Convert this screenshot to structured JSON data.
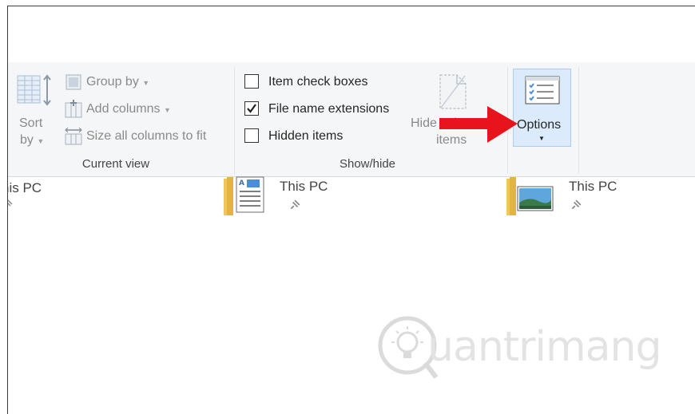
{
  "ribbon": {
    "current_view": {
      "label": "Current view",
      "sort_by_line1": "Sort",
      "sort_by_line2": "by",
      "group_by": "Group by",
      "add_columns": "Add columns",
      "size_columns": "Size all columns to fit"
    },
    "show_hide": {
      "label": "Show/hide",
      "item_check_boxes": "Item check boxes",
      "item_check_boxes_checked": false,
      "file_name_extensions": "File name extensions",
      "file_name_extensions_checked": true,
      "hidden_items": "Hidden items",
      "hidden_items_checked": false,
      "hide_selected_line1": "Hide selected",
      "hide_selected_line2": "items"
    },
    "options": {
      "label": "Options"
    }
  },
  "files": [
    {
      "name": "his PC"
    },
    {
      "name": "This PC"
    },
    {
      "name": "This PC"
    }
  ],
  "watermark": {
    "text": "uantrimang"
  },
  "colors": {
    "arrow": "#e8141b",
    "options_bg": "#dcebfc",
    "options_border": "#a8cdf0"
  }
}
